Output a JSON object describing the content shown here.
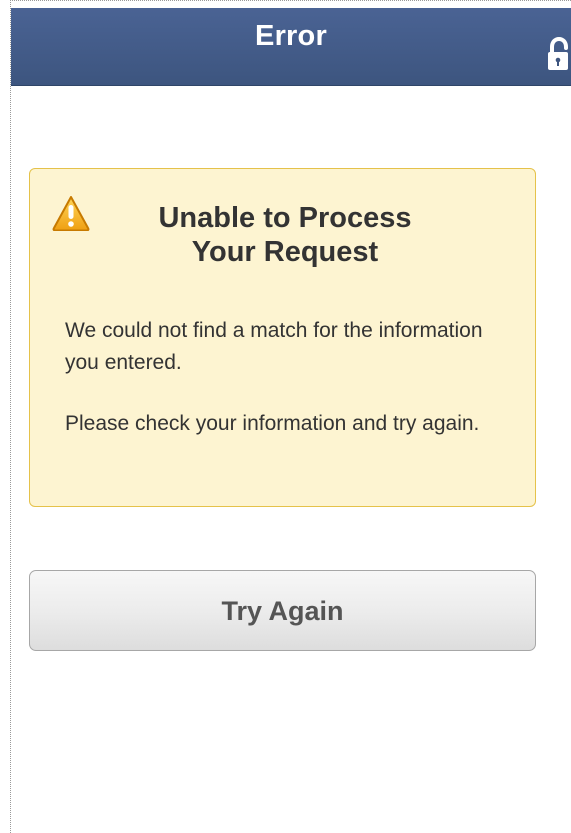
{
  "header": {
    "title": "Error",
    "lock_icon": "lock-icon"
  },
  "alert": {
    "icon": "warning-icon",
    "title_line1": "Unable to Process",
    "title_line2": "Your Request",
    "message1": "We could not find a match for the information you entered.",
    "message2": "Please check your information and try again.",
    "background_color": "#fdf4d1",
    "border_color": "#e5c24a"
  },
  "actions": {
    "try_again_label": "Try Again"
  },
  "colors": {
    "header": "#4a6394",
    "warning": "#f0ad22"
  }
}
